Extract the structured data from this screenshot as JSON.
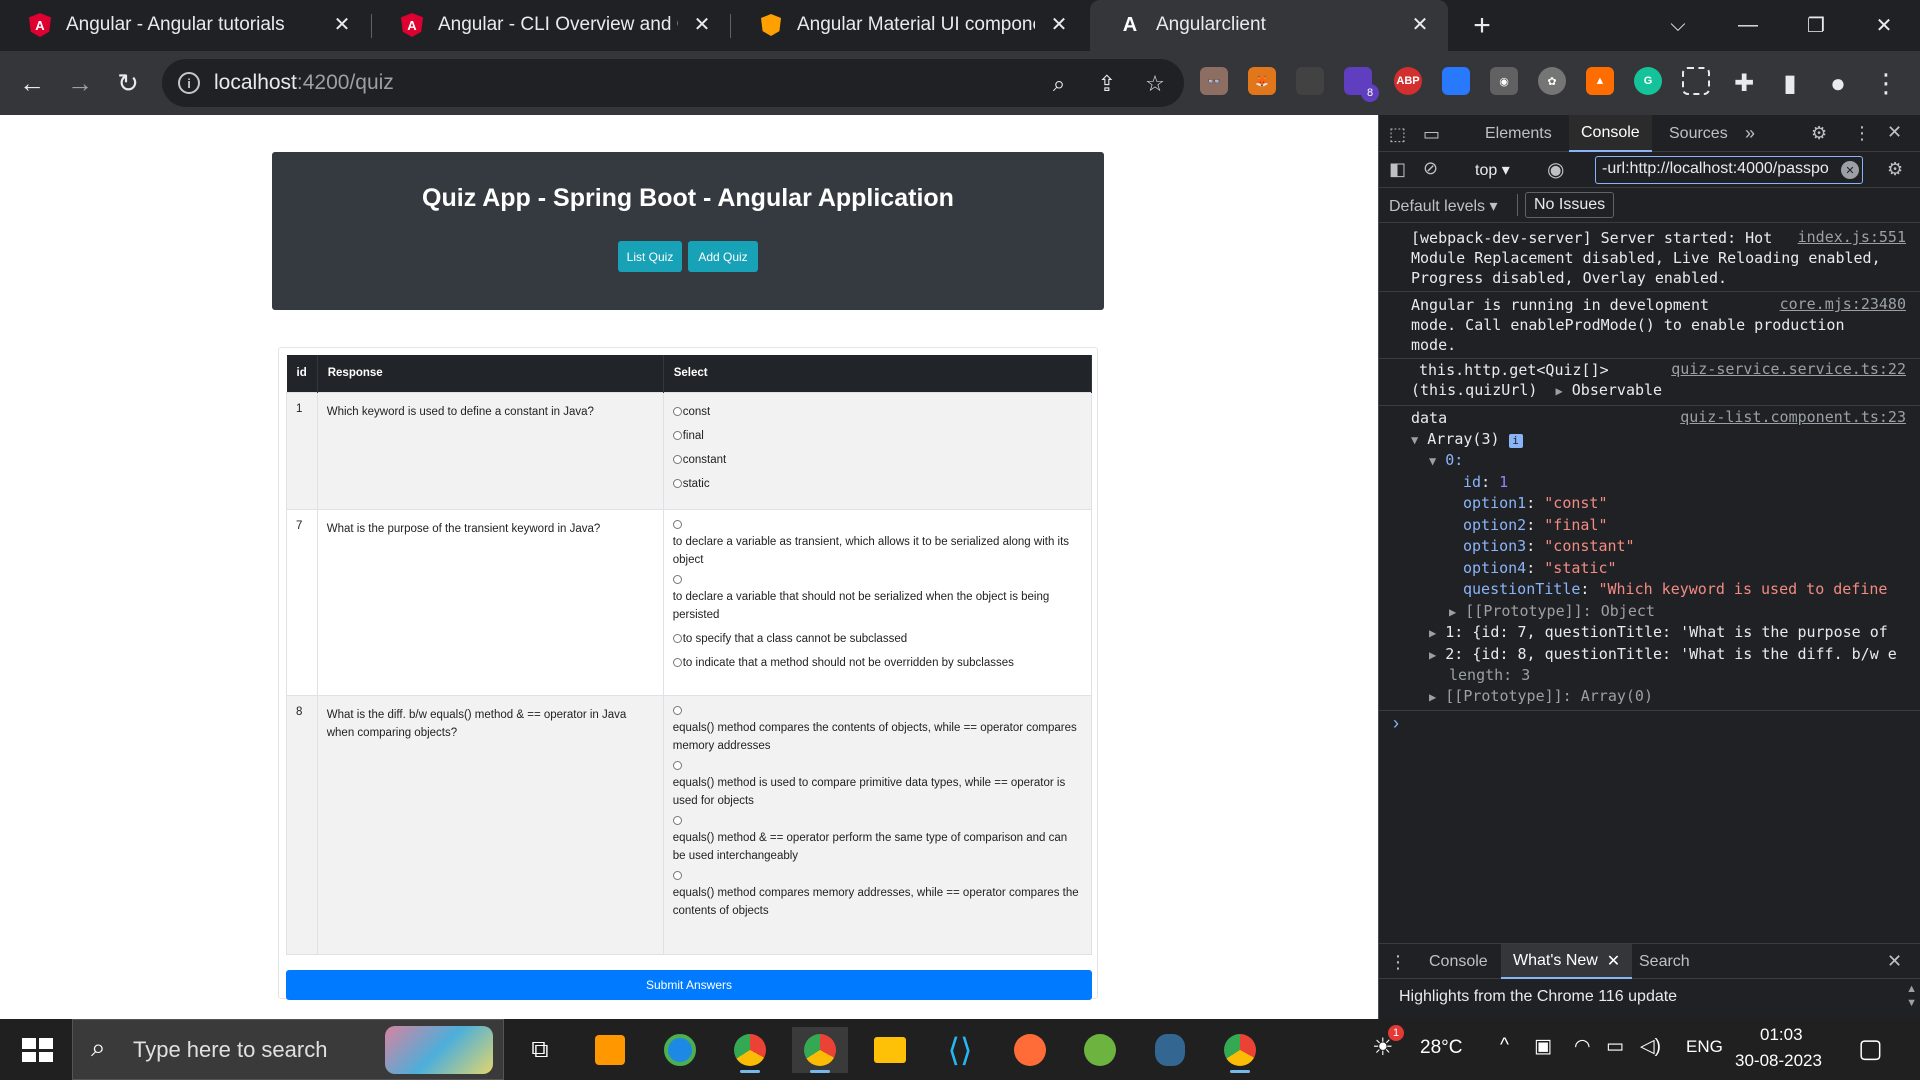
{
  "browser": {
    "tabs": [
      {
        "title": "Angular - Angular tutorials",
        "icon": "angular-icon",
        "active": false
      },
      {
        "title": "Angular - CLI Overview and Comm",
        "icon": "angular-icon",
        "active": false
      },
      {
        "title": "Angular Material UI component l",
        "icon": "angular-material-icon",
        "active": false
      },
      {
        "title": "Angularclient",
        "icon": "angular-a-icon",
        "active": true
      }
    ],
    "url_host": "localhost",
    "url_path": ":4200/quiz",
    "extension_badge": "8",
    "extensions": [
      "glasses-icon",
      "metamask-icon",
      "bottle-icon",
      "hexagon-icon",
      "ABP",
      "wappalyzer-icon",
      "camera-icon",
      "openai-icon",
      "rocket-icon",
      "grammarly-icon",
      "screenshot-icon",
      "puzzle-icon",
      "sidepanel-icon",
      "profile-icon",
      "menu-icon"
    ]
  },
  "page": {
    "title": "Quiz App - Spring Boot - Angular Application",
    "buttons": {
      "list": "List Quiz",
      "add": "Add Quiz"
    },
    "table": {
      "headers": [
        "id",
        "Response",
        "Select"
      ],
      "rows": [
        {
          "id": "1",
          "question": "Which keyword is used to define a constant in Java?",
          "options": [
            "const",
            "final",
            "constant",
            "static"
          ],
          "layout": "inline"
        },
        {
          "id": "7",
          "question": "What is the purpose of the transient keyword in Java?",
          "options": [
            "to declare a variable as transient, which allows it to be serialized along with its object",
            "to declare a variable that should not be serialized when the object is being persisted",
            "to specify that a class cannot be subclassed",
            "to indicate that a method should not be overridden by subclasses"
          ],
          "layout": "mixed"
        },
        {
          "id": "8",
          "question": "What is the diff. b/w equals() method & == operator in Java when comparing objects?",
          "options": [
            "equals() method compares the contents of objects, while == operator compares memory addresses",
            "equals() method is used to compare primitive data types, while == operator is used for objects",
            "equals() method & == operator perform the same type of comparison and can be used interchangeably",
            "equals() method compares memory addresses, while == operator compares the contents of objects"
          ],
          "layout": "block"
        }
      ]
    },
    "submit_label": "Submit Answers"
  },
  "devtools": {
    "tabs": [
      "Elements",
      "Console",
      "Sources"
    ],
    "active_tab": "Console",
    "context": "top",
    "filter": "-url:http://localhost:4000/passpo",
    "levels": "Default levels",
    "issues": "No Issues",
    "logs": {
      "l1_text": "[webpack-dev-server] Server started: Hot\nModule Replacement disabled, Live Reloading enabled,\nProgress disabled, Overlay enabled.",
      "l1_link": "index.js:551",
      "l2_text": "Angular is running in development\nmode. Call enableProdMode() to enable production\nmode.",
      "l2_link": "core.mjs:23480",
      "l3_text": "this.http.get<Quiz[]>",
      "l3_text2": "(this.quizUrl)",
      "l3_obs": "Observable",
      "l3_link": "quiz-service.service.ts:22",
      "l4_label": "data",
      "l4_link": "quiz-list.component.ts:23",
      "array_label": "Array(3)",
      "item0_label": "0:",
      "fields": [
        {
          "key": "id",
          "value": "1"
        },
        {
          "key": "option1",
          "value": "\"const\""
        },
        {
          "key": "option2",
          "value": "\"final\""
        },
        {
          "key": "option3",
          "value": "\"constant\""
        },
        {
          "key": "option4",
          "value": "\"static\""
        },
        {
          "key": "questionTitle",
          "value": "\"Which keyword is used to define"
        }
      ],
      "proto_obj": "[[Prototype]]: Object",
      "item1": "1: {id: 7, questionTitle: 'What is the purpose of",
      "item2": "2: {id: 8, questionTitle: 'What is the diff. b/w e",
      "length": "length: 3",
      "proto_arr": "[[Prototype]]: Array(0)"
    },
    "drawer_tabs": [
      "Console",
      "What's New",
      "Search"
    ],
    "drawer_active": "What's New",
    "drawer_text": "Highlights from the Chrome 116 update"
  },
  "taskbar": {
    "search_placeholder": "Type here to search",
    "temperature": "28°C",
    "language": "ENG",
    "time": "01:03",
    "date": "30-08-2023",
    "weather_badge": "1"
  },
  "colors": {
    "accent": "#17a2b8",
    "primary": "#007bff",
    "dark": "#343a40",
    "devtools_bg": "#202124"
  }
}
